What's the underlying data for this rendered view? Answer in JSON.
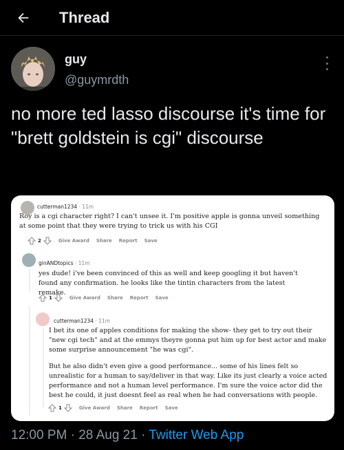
{
  "header": {
    "title": "Thread"
  },
  "author": {
    "display_name": "guy",
    "handle": "@guymrdth"
  },
  "tweet": {
    "text": "no more ted lasso discourse it's time for \"brett goldstein is cgi\" discourse"
  },
  "embedded_image": {
    "comments": [
      {
        "username": "cutterman1234",
        "time": "· 11m",
        "body": "Roy is a cgi character right? I can't unsee it. I'm positive apple is gonna unveil something at some point that they were trying to trick us with his CGI",
        "score": "2",
        "actions": [
          "Give Award",
          "Share",
          "Report",
          "Save"
        ]
      },
      {
        "username": "ginANDtopics",
        "time": "· 11m",
        "body": "yes dude! i've been convinced of this as well and keep googling it but haven't found any confirmation. he looks like the tintin characters from the latest remake.",
        "score": "1",
        "actions": [
          "Give Award",
          "Share",
          "Report",
          "Save"
        ]
      },
      {
        "username": "cutterman1234",
        "time": "· 11m",
        "body": "I bet its one of apples conditions for making the show- they get to try out their \"new cgi tech\" and at the emmys theyre gonna put him up for best actor and make some surprise announcement \"he was cgi\".",
        "body2": "But he also didn't even give a good performance... some of his lines felt so unrealistic for a human to say/deliver in that way. Like its just clearly a voice acted performance and not a human level performance. I'm sure the voice actor did the best he could, it just doesnt feel as real when he had conversations with people.",
        "score": "1",
        "actions": [
          "Give Award",
          "Share",
          "Report",
          "Save"
        ]
      }
    ]
  },
  "footer": {
    "time": "12:00 PM",
    "date": "28 Aug 21",
    "separator": "·",
    "source": "Twitter Web App"
  },
  "colors": {
    "background": "#000000",
    "link": "#1d9bf0",
    "secondary": "#8b98a5",
    "text": "#e7e9ea"
  }
}
